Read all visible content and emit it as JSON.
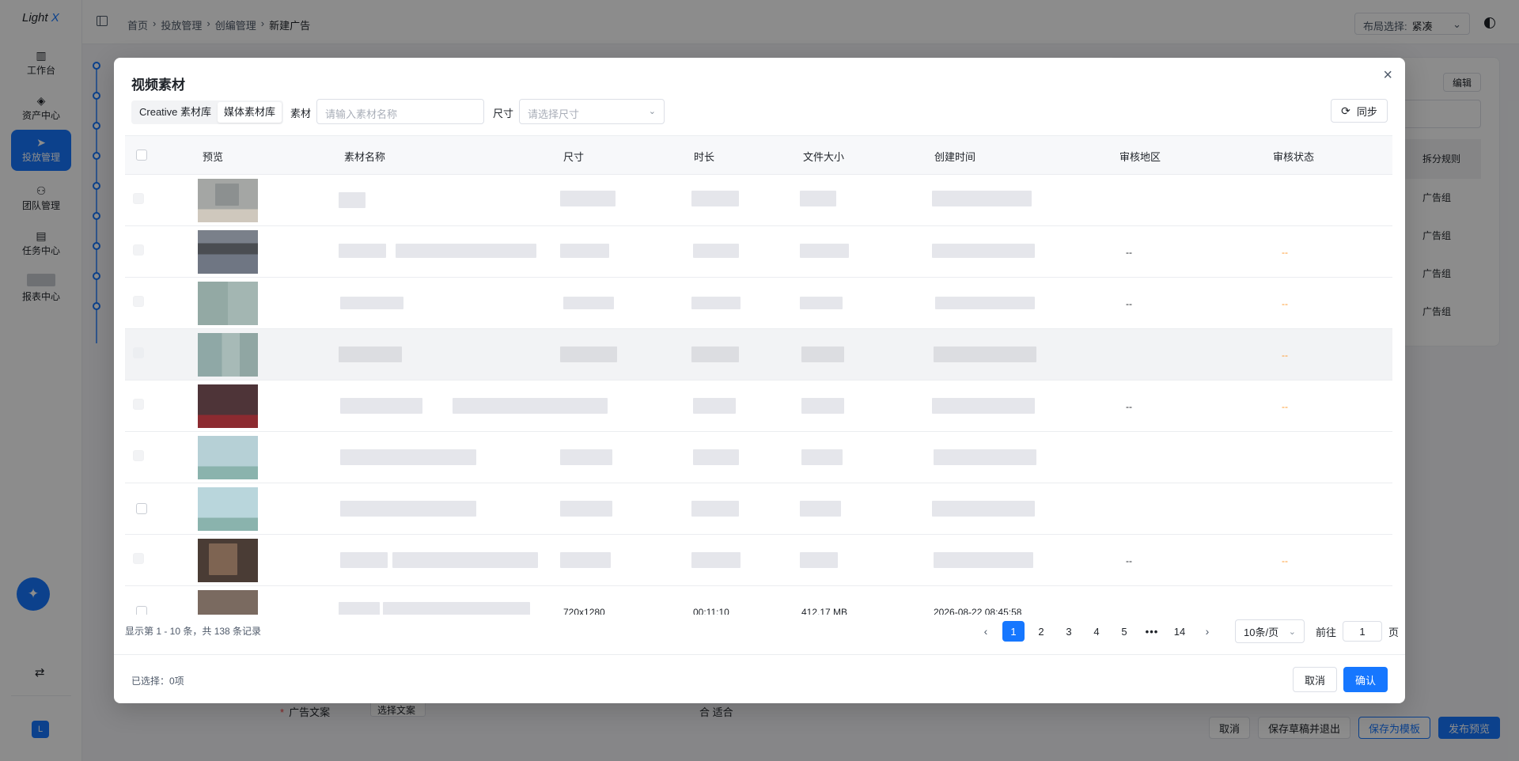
{
  "sidebar": {
    "logo": {
      "main": "Light",
      "accent": "X"
    },
    "items": [
      {
        "label": "工作台",
        "icon": "bar-chart-icon"
      },
      {
        "label": "资产中心",
        "icon": "layers-icon"
      },
      {
        "label": "投放管理",
        "icon": "send-icon",
        "active": true
      },
      {
        "label": "团队管理",
        "icon": "users-icon"
      },
      {
        "label": "任务中心",
        "icon": "clipboard-icon"
      },
      {
        "label": "报表中心",
        "icon": "report-icon"
      }
    ],
    "avatar": "L"
  },
  "topbar": {
    "breadcrumb": [
      "首页",
      "投放管理",
      "创编管理",
      "新建广告"
    ],
    "layout_label": "布局选择:",
    "layout_value": "紧凑"
  },
  "background": {
    "edit_button": "编辑",
    "table_header": "拆分规则",
    "cells": [
      "广告组",
      "广告组",
      "广告组",
      "广告组"
    ],
    "bottom_label": "广告文案",
    "bottom_select": "选择文案",
    "bottom_text": "合 适合",
    "actions": [
      "取消",
      "保存草稿并退出",
      "保存为模板",
      "发布预览"
    ]
  },
  "modal": {
    "title": "视频素材",
    "tabs": [
      "Creative 素材库",
      "媒体素材库"
    ],
    "filter": {
      "material_label": "素材",
      "material_placeholder": "请输入素材名称",
      "size_label": "尺寸",
      "size_placeholder": "请选择尺寸"
    },
    "sync_label": "同步",
    "columns": [
      "预览",
      "素材名称",
      "尺寸",
      "时长",
      "文件大小",
      "创建时间",
      "审核地区",
      "审核状态"
    ],
    "rows": [
      {
        "region": "",
        "status": ""
      },
      {
        "region": "--",
        "status": "--"
      },
      {
        "region": "--",
        "status": "--"
      },
      {
        "region": "",
        "status": "--"
      },
      {
        "region": "--",
        "status": "--"
      },
      {
        "region": "",
        "status": ""
      },
      {
        "region": "",
        "status": ""
      },
      {
        "region": "--",
        "status": "--"
      },
      {
        "size": "720x1280",
        "duration": "00:11:10",
        "filesize": "412.17 MB",
        "created": "2026-08-22 08:45:58",
        "region": "",
        "status": ""
      }
    ],
    "pagination": {
      "info": "显示第 1 - 10 条，共 138 条记录",
      "pages": [
        "1",
        "2",
        "3",
        "4",
        "5",
        "•••",
        "14"
      ],
      "current": "1",
      "page_size": "10条/页",
      "goto_label": "前往",
      "goto_value": "1",
      "goto_unit": "页"
    },
    "footer": {
      "selected": "已选择：0项",
      "cancel": "取消",
      "confirm": "确认"
    }
  },
  "colors": {
    "primary": "#1677ff",
    "warning": "#ff9a2e"
  }
}
